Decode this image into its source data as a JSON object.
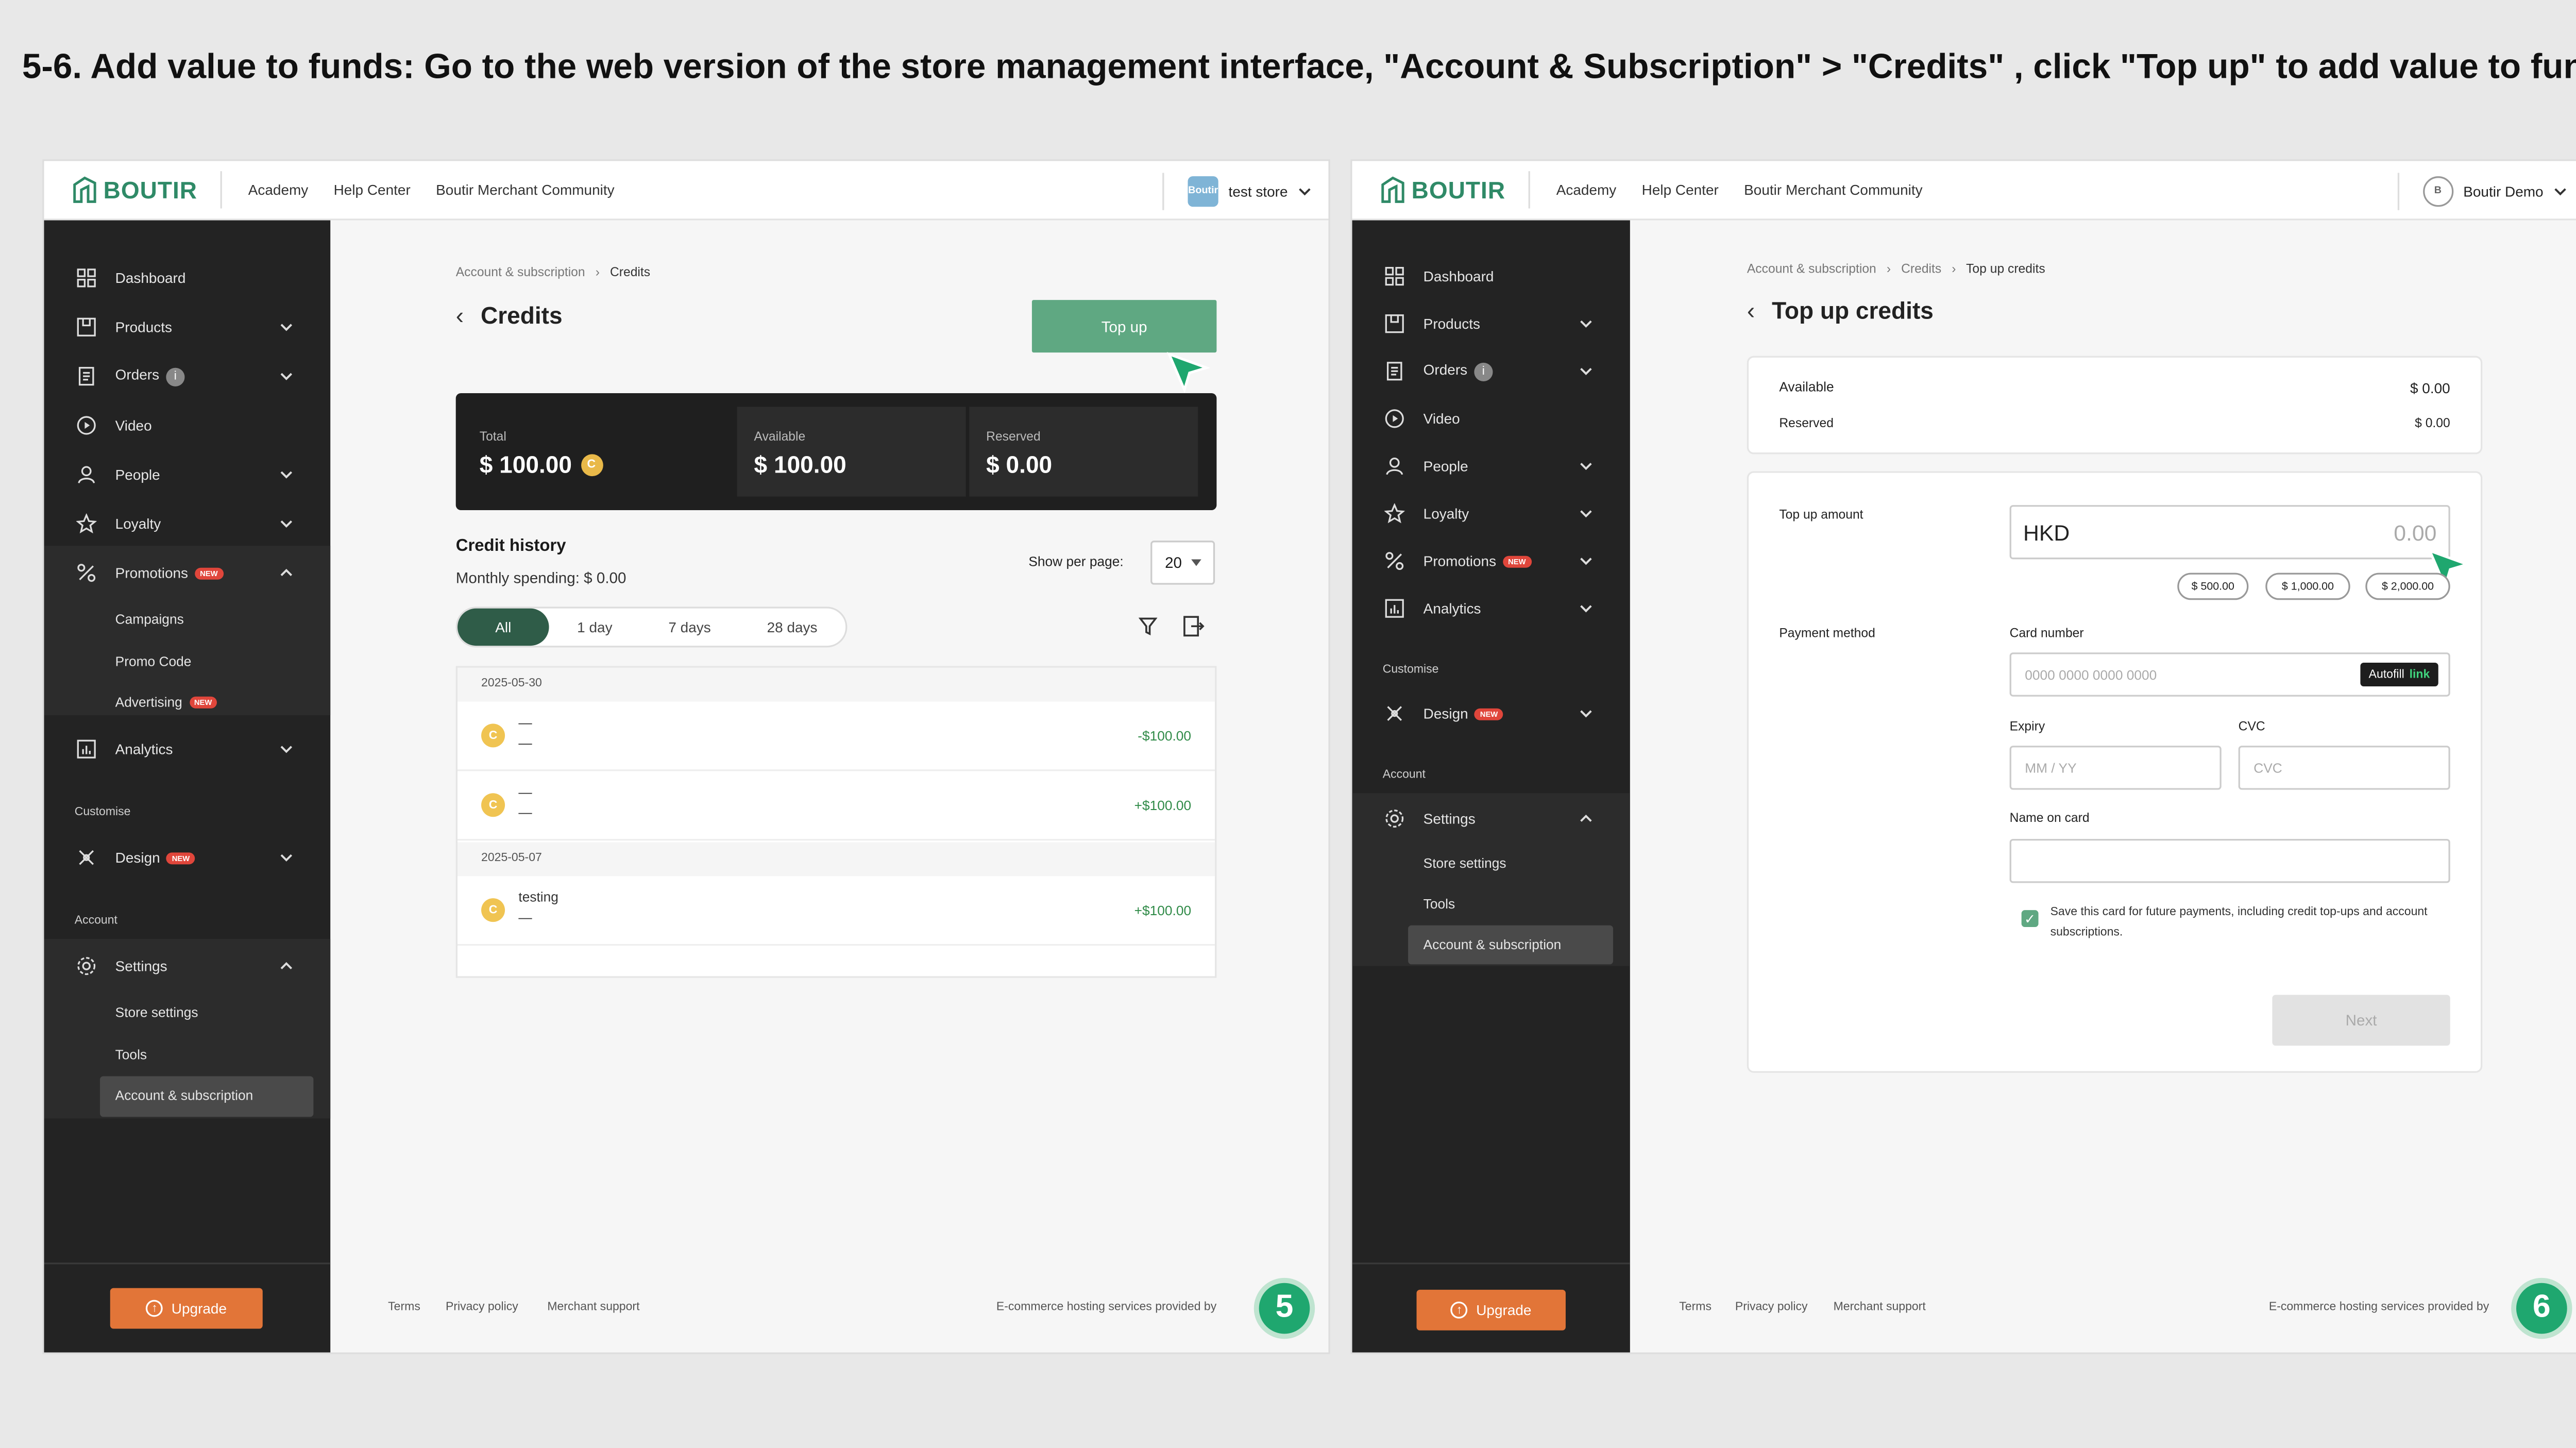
{
  "instruction": "5-6. Add value to funds: Go to the web version of the store management interface, \"Account & Subscription\" > \"Credits\"  , click \"Top up\" to add value to funds.",
  "colors": {
    "brand_green": "#2f8a67",
    "top_up_button": "#5fa882",
    "sidebar": "#232323",
    "upgrade": "#e27538",
    "step_badge": "#1fa76f"
  },
  "topnav": {
    "brand": "BOUTIR",
    "links": [
      "Academy",
      "Help Center",
      "Boutir Merchant Community"
    ]
  },
  "left": {
    "store_name": "test store",
    "store_icon_text": "Boutir",
    "nav": {
      "dashboard": "Dashboard",
      "products": "Products",
      "orders": "Orders",
      "orders_badge": "i",
      "video": "Video",
      "people": "People",
      "loyalty": "Loyalty",
      "promotions": "Promotions",
      "campaigns": "Campaigns",
      "promo_code": "Promo Code",
      "advertising": "Advertising",
      "analytics": "Analytics",
      "customise": "Customise",
      "design": "Design",
      "account": "Account",
      "settings": "Settings",
      "store_settings": "Store settings",
      "tools": "Tools",
      "account_subscription": "Account & subscription",
      "new_badge": "NEW"
    },
    "upgrade": "Upgrade",
    "breadcrumb": {
      "parent": "Account & subscription",
      "sep": "›",
      "current": "Credits"
    },
    "title": "Credits",
    "back": "‹",
    "top_up_button": "Top up",
    "summary": {
      "total_label": "Total",
      "total_value": "$ 100.00",
      "available_label": "Available",
      "available_value": "$ 100.00",
      "reserved_label": "Reserved",
      "reserved_value": "$ 0.00",
      "coin": "C"
    },
    "history_title": "Credit history",
    "monthly_spending": "Monthly spending: $ 0.00",
    "show_per_page_label": "Show per page:",
    "show_per_page_value": "20",
    "tabs": [
      "All",
      "1 day",
      "7 days",
      "28 days"
    ],
    "history": [
      {
        "date": "2025-05-30",
        "rows": [
          {
            "line1": "—",
            "line2": "—",
            "amount": "-$100.00"
          },
          {
            "line1": "—",
            "line2": "—",
            "amount": "+$100.00"
          }
        ]
      },
      {
        "date": "2025-05-07",
        "rows": [
          {
            "line1": "testing",
            "line2": "—",
            "amount": "+$100.00"
          }
        ]
      }
    ],
    "footer": {
      "terms": "Terms",
      "privacy": "Privacy policy",
      "support": "Merchant support",
      "hosting": "E-commerce hosting services provided by"
    },
    "step": "5"
  },
  "right": {
    "store_name": "Boutir Demo",
    "store_icon_text": "B",
    "nav": {
      "dashboard": "Dashboard",
      "products": "Products",
      "orders": "Orders",
      "orders_badge": "i",
      "video": "Video",
      "people": "People",
      "loyalty": "Loyalty",
      "promotions": "Promotions",
      "analytics": "Analytics",
      "customise": "Customise",
      "design": "Design",
      "account": "Account",
      "settings": "Settings",
      "store_settings": "Store settings",
      "tools": "Tools",
      "account_subscription": "Account & subscription",
      "new_badge": "NEW"
    },
    "upgrade": "Upgrade",
    "breadcrumb": {
      "root": "Account & subscription",
      "sep": "›",
      "middle": "Credits",
      "current": "Top up credits"
    },
    "title": "Top up credits",
    "back": "‹",
    "balance": {
      "available_label": "Available",
      "available_value": "$ 0.00",
      "reserved_label": "Reserved",
      "reserved_value": "$ 0.00"
    },
    "top_up_amount_label": "Top up amount",
    "currency": "HKD",
    "amount_placeholder": "0.00",
    "presets": [
      "$ 500.00",
      "$ 1,000.00",
      "$ 2,000.00"
    ],
    "payment_method_label": "Payment method",
    "card_number_label": "Card number",
    "card_number_placeholder": "0000 0000 0000 0000",
    "autofill": "Autofill",
    "autofill_link": "link",
    "expiry_label": "Expiry",
    "expiry_placeholder": "MM / YY",
    "cvc_label": "CVC",
    "cvc_placeholder": "CVC",
    "name_label": "Name on card",
    "save_card_text": "Save this card for future payments, including credit top-ups and account subscriptions.",
    "next_button": "Next",
    "footer": {
      "terms": "Terms",
      "privacy": "Privacy policy",
      "support": "Merchant support",
      "hosting": "E-commerce hosting services provided by"
    },
    "step": "6"
  }
}
